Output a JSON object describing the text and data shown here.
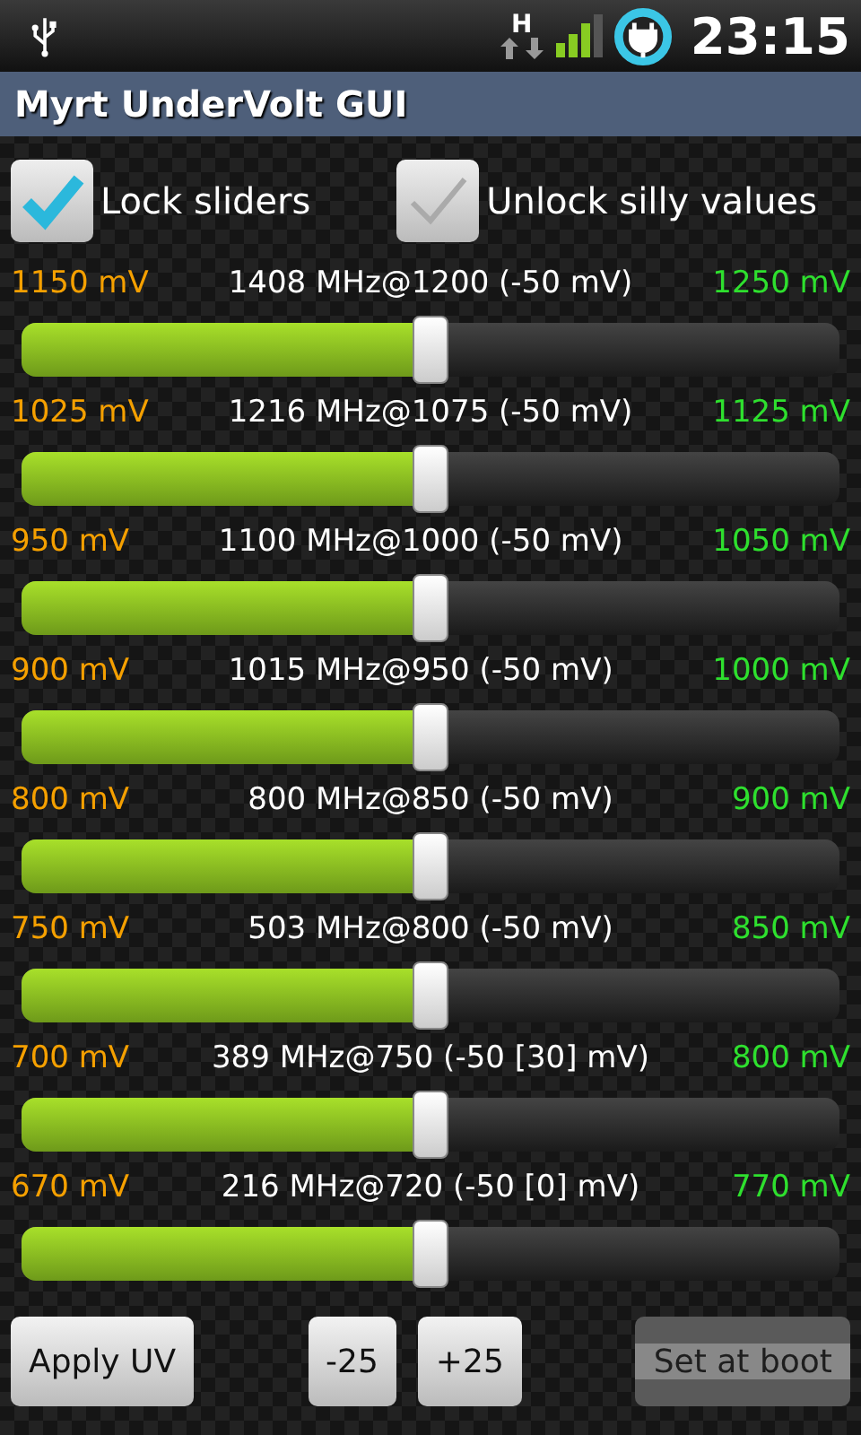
{
  "status_bar": {
    "network": "H",
    "time": "23:15"
  },
  "title": "Myrt UnderVolt GUI",
  "checkboxes": [
    {
      "label": "Lock sliders",
      "checked": true
    },
    {
      "label": "Unlock silly values",
      "checked": false
    }
  ],
  "sliders": [
    {
      "min": "1150 mV",
      "label": "1408 MHz@1200 (-50 mV)",
      "max": "1250 mV",
      "level": 0.5
    },
    {
      "min": "1025 mV",
      "label": "1216 MHz@1075 (-50 mV)",
      "max": "1125 mV",
      "level": 0.5
    },
    {
      "min": "950 mV",
      "label": "1100 MHz@1000 (-50 mV)",
      "max": "1050 mV",
      "level": 0.5
    },
    {
      "min": "900 mV",
      "label": "1015 MHz@950 (-50 mV)",
      "max": "1000 mV",
      "level": 0.5
    },
    {
      "min": "800 mV",
      "label": "800 MHz@850 (-50 mV)",
      "max": "900 mV",
      "level": 0.5
    },
    {
      "min": "750 mV",
      "label": "503 MHz@800 (-50 mV)",
      "max": "850 mV",
      "level": 0.5
    },
    {
      "min": "700 mV",
      "label": "389 MHz@750 (-50 [30] mV)",
      "max": "800 mV",
      "level": 0.5
    },
    {
      "min": "670 mV",
      "label": "216 MHz@720 (-50 [0] mV)",
      "max": "770 mV",
      "level": 0.5
    }
  ],
  "buttons": [
    {
      "label": "Apply UV",
      "disabled": false
    },
    {
      "label": "-25",
      "disabled": false
    },
    {
      "label": "+25",
      "disabled": false
    },
    {
      "label": "Set at boot",
      "disabled": true
    }
  ]
}
